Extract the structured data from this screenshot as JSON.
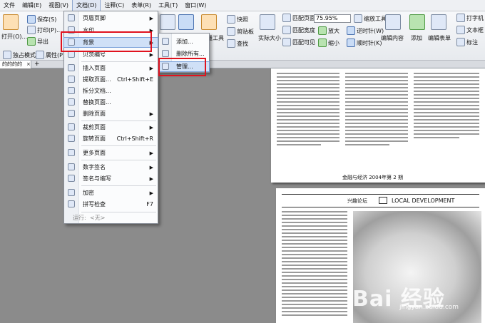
{
  "menubar": {
    "items": [
      "文件",
      "编辑(E)",
      "视图(V)",
      "文档(D)",
      "注释(C)",
      "表单(R)",
      "工具(T)",
      "窗口(W)"
    ],
    "active_index": 3
  },
  "toolbar": {
    "open": "打开(O)...",
    "save": "保存(S)",
    "print": "打印(P)...",
    "import": "导出",
    "exclusive_mode": "独占模式",
    "properties": "属性(P)...",
    "quick_photo": "快照",
    "clipboard": "剪贴板",
    "find": "查找",
    "ruler_tool": "测量工具",
    "actual_size": "实际大小",
    "fit_page": "匹配页面",
    "fit_width": "匹配宽度",
    "fit_visible": "匹配可见",
    "zoom_value": "75.95%",
    "zoom_tool": "缩放工具",
    "zoom_in": "放大",
    "zoom_out": "缩小",
    "rotate_ccw": "逆时针(W)",
    "rotate_cw": "顺时针(K)",
    "edit_content": "编辑内容",
    "add": "添加",
    "edit_form": "编辑表单",
    "typewriter": "打字机",
    "textbox": "文本框",
    "callout": "标注"
  },
  "tab": {
    "label": "的的的的",
    "close": "×",
    "add": "+"
  },
  "document_menu": {
    "items": [
      {
        "label": "页眉页脚",
        "shortcut": "",
        "submenu": true
      },
      {
        "label": "水印",
        "shortcut": "",
        "submenu": true
      },
      {
        "label": "背景",
        "shortcut": "",
        "submenu": true
      },
      {
        "label": "贝茨编号",
        "shortcut": "",
        "submenu": true
      },
      {
        "label": "插入页面",
        "shortcut": "",
        "submenu": true
      },
      {
        "label": "提取页面...",
        "shortcut": "Ctrl+Shift+E",
        "submenu": false
      },
      {
        "label": "拆分文档...",
        "shortcut": "",
        "submenu": false
      },
      {
        "label": "替换页面...",
        "shortcut": "",
        "submenu": false
      },
      {
        "label": "删除页面",
        "shortcut": "",
        "submenu": true
      },
      {
        "label": "裁剪页面",
        "shortcut": "",
        "submenu": true
      },
      {
        "label": "旋转页面",
        "shortcut": "Ctrl+Shift+R",
        "submenu": false
      },
      {
        "label": "更多页面",
        "shortcut": "",
        "submenu": true
      },
      {
        "label": "数字签名",
        "shortcut": "",
        "submenu": true
      },
      {
        "label": "签名与缩写",
        "shortcut": "",
        "submenu": true
      },
      {
        "label": "加密",
        "shortcut": "",
        "submenu": true
      },
      {
        "label": "拼写检查",
        "shortcut": "F7",
        "submenu": false
      }
    ],
    "run_label": "运行:",
    "run_value": "<无>"
  },
  "background_submenu": {
    "items": [
      "添加...",
      "删除所有...",
      "管理..."
    ]
  },
  "page_top": {
    "footer": "金融与经济   2004年第 2 期"
  },
  "page_bottom": {
    "header_left": "兴趣论坛",
    "header_right": "LOCAL DEVELOPMENT"
  },
  "watermark": {
    "text": "Bai 经验",
    "sub": "jingyan.baidu.com"
  }
}
